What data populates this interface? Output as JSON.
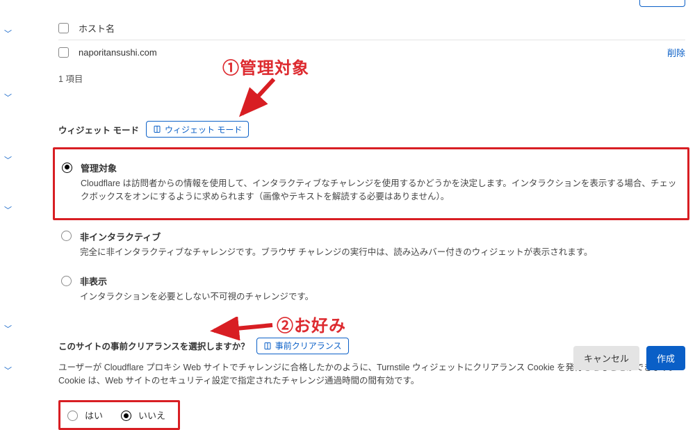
{
  "table": {
    "header": "ホスト名",
    "row_value": "naporitansushi.com",
    "delete": "削除",
    "count": "1 項目"
  },
  "widgetMode": {
    "label": "ウィジェット モード",
    "pill": "ウィジェット モード",
    "options": [
      {
        "title": "管理対象",
        "desc": "Cloudflare は訪問者からの情報を使用して、インタラクティブなチャレンジを使用するかどうかを決定します。インタラクションを表示する場合、チェックボックスをオンにするように求められます（画像やテキストを解読する必要はありません）。",
        "checked": true
      },
      {
        "title": "非インタラクティブ",
        "desc": "完全に非インタラクティブなチャレンジです。ブラウザ チャレンジの実行中は、読み込みバー付きのウィジェットが表示されます。",
        "checked": false
      },
      {
        "title": "非表示",
        "desc": "インタラクションを必要としない不可視のチャレンジです。",
        "checked": false
      }
    ]
  },
  "preclearance": {
    "question": "このサイトの事前クリアランスを選択しますか？",
    "pill": "事前クリアランス",
    "help": "ユーザーが Cloudflare プロキシ Web サイトでチャレンジに合格したかのように、Turnstile ウィジェットにクリアランス Cookie を発行させることができます。Cookie は、Web サイトのセキュリティ設定で指定されたチャレンジ通過時間の間有効です。",
    "yes": "はい",
    "no": "いいえ",
    "selected": "no"
  },
  "buttons": {
    "cancel": "キャンセル",
    "create": "作成"
  },
  "annot": {
    "a1": "①管理対象",
    "a2": "②お好み"
  }
}
